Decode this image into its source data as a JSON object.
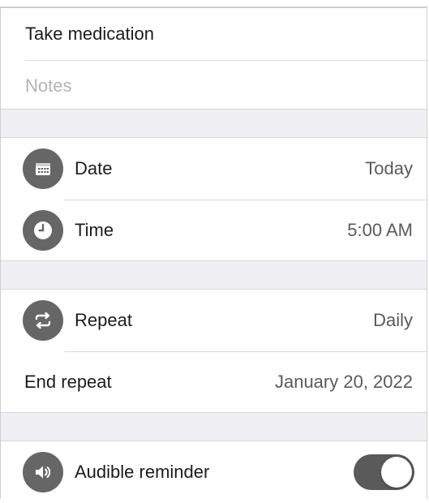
{
  "reminder": {
    "title": "Take medication",
    "notes_placeholder": "Notes"
  },
  "schedule": {
    "date": {
      "label": "Date",
      "value": "Today",
      "icon": "calendar-icon"
    },
    "time": {
      "label": "Time",
      "value": "5:00 AM",
      "icon": "clock-icon"
    }
  },
  "repeat": {
    "repeat": {
      "label": "Repeat",
      "value": "Daily",
      "icon": "repeat-icon"
    },
    "end_repeat": {
      "label": "End repeat",
      "value": "January 20, 2022"
    }
  },
  "audible": {
    "label": "Audible reminder",
    "icon": "speaker-icon",
    "enabled": true
  },
  "colors": {
    "icon_bg": "#666666",
    "toggle_on": "#5a5a5a",
    "group_gap": "#efeff4"
  }
}
